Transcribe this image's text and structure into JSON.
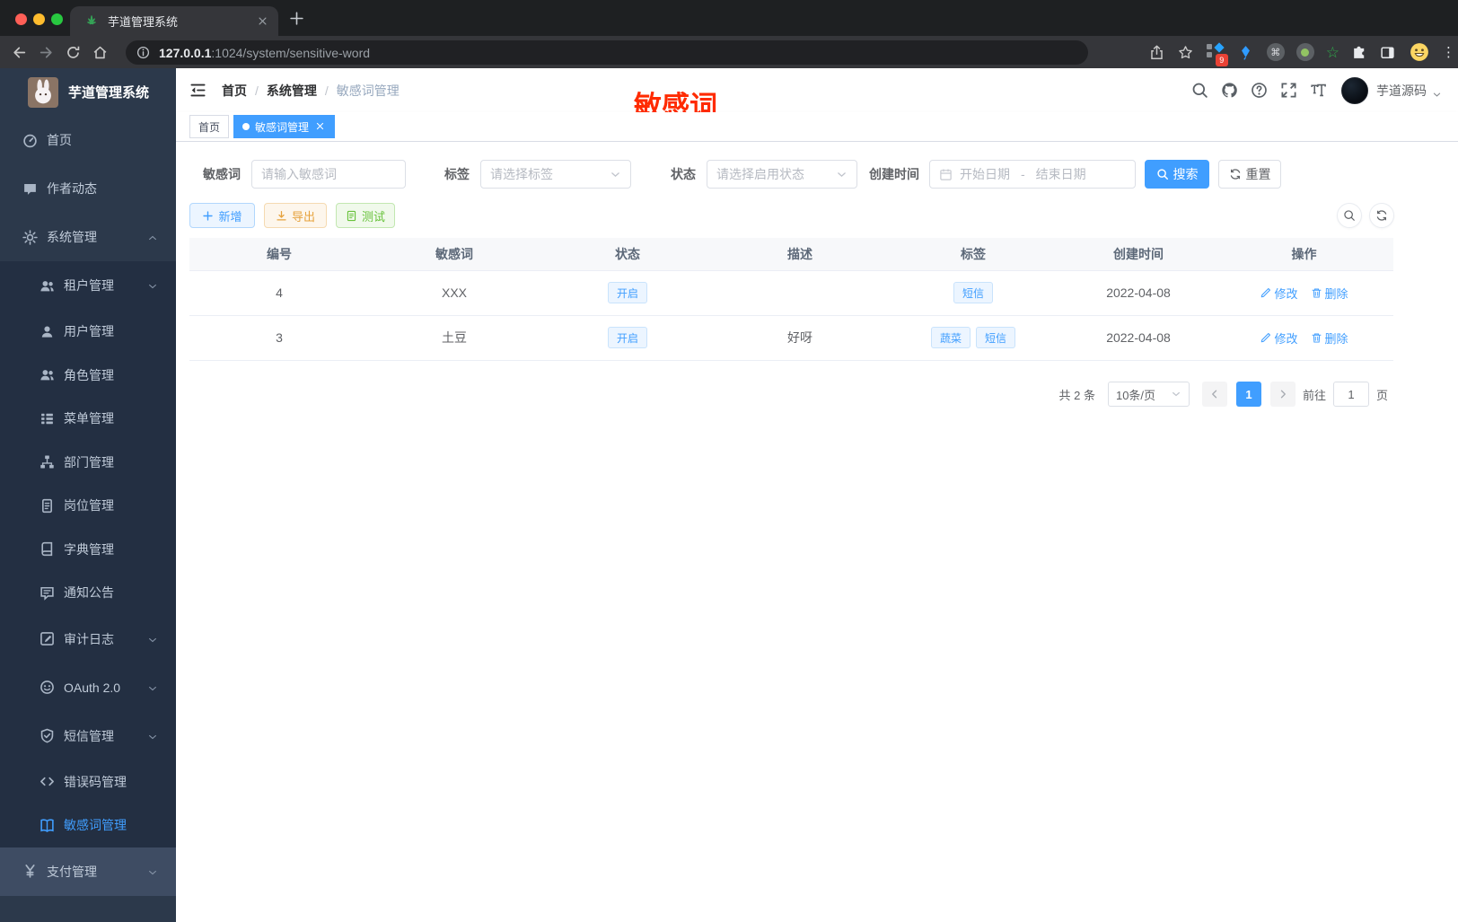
{
  "browser": {
    "tab_title": "芋道管理系统",
    "url_host": "127.0.0.1",
    "url_rest": ":1024/system/sensitive-word",
    "extensions_badge": "9"
  },
  "sidebar": {
    "logo_title": "芋道管理系统",
    "items": [
      {
        "key": "home",
        "icon": "dashboard",
        "label": "首页",
        "type": "top"
      },
      {
        "key": "author-news",
        "icon": "chat",
        "label": "作者动态",
        "type": "top"
      },
      {
        "key": "system",
        "icon": "gear",
        "label": "系统管理",
        "type": "top",
        "caret": "up"
      },
      {
        "key": "tenant",
        "icon": "users",
        "label": "租户管理",
        "type": "sub",
        "caret": "down"
      },
      {
        "key": "user",
        "icon": "user",
        "label": "用户管理",
        "type": "sub"
      },
      {
        "key": "role",
        "icon": "users",
        "label": "角色管理",
        "type": "sub"
      },
      {
        "key": "menu",
        "icon": "menu",
        "label": "菜单管理",
        "type": "sub"
      },
      {
        "key": "dept",
        "icon": "org",
        "label": "部门管理",
        "type": "sub"
      },
      {
        "key": "post",
        "icon": "post",
        "label": "岗位管理",
        "type": "sub"
      },
      {
        "key": "dict",
        "icon": "dict",
        "label": "字典管理",
        "type": "sub"
      },
      {
        "key": "notice",
        "icon": "notice",
        "label": "通知公告",
        "type": "sub"
      },
      {
        "key": "audit-log",
        "icon": "log",
        "label": "审计日志",
        "type": "sub",
        "caret": "down"
      },
      {
        "key": "oauth2",
        "icon": "oauth",
        "label": "OAuth 2.0",
        "type": "sub",
        "caret": "down"
      },
      {
        "key": "sms",
        "icon": "shield",
        "label": "短信管理",
        "type": "sub",
        "caret": "down"
      },
      {
        "key": "error-code",
        "icon": "code",
        "label": "错误码管理",
        "type": "sub"
      },
      {
        "key": "sensitive-word",
        "icon": "book",
        "label": "敏感词管理",
        "type": "sub",
        "active": true
      },
      {
        "key": "pay",
        "icon": "yen",
        "label": "支付管理",
        "type": "top",
        "caret": "down",
        "highlight": true
      }
    ]
  },
  "header": {
    "breadcrumb": [
      {
        "label": "首页"
      },
      {
        "label": "系统管理"
      },
      {
        "label": "敏感词管理",
        "current": true
      }
    ],
    "username": "芋道源码",
    "annotation": "敏感词"
  },
  "tabs": [
    {
      "key": "home",
      "label": "首页"
    },
    {
      "key": "sensitive-word",
      "label": "敏感词管理",
      "active": true,
      "closable": true
    }
  ],
  "filters": {
    "keyword": {
      "label": "敏感词",
      "placeholder": "请输入敏感词"
    },
    "tag": {
      "label": "标签",
      "placeholder": "请选择标签"
    },
    "status": {
      "label": "状态",
      "placeholder": "请选择启用状态"
    },
    "create_time": {
      "label": "创建时间",
      "start_placeholder": "开始日期",
      "separator": "-",
      "end_placeholder": "结束日期"
    },
    "search_label": "搜索",
    "reset_label": "重置"
  },
  "toolbar": {
    "add_label": "新增",
    "export_label": "导出",
    "test_label": "测试"
  },
  "table": {
    "headers": [
      "编号",
      "敏感词",
      "状态",
      "描述",
      "标签",
      "创建时间",
      "操作"
    ],
    "rows": [
      {
        "id": "4",
        "word": "XXX",
        "status": "开启",
        "description": "",
        "tags": [
          "短信"
        ],
        "created_at": "2022-04-08"
      },
      {
        "id": "3",
        "word": "土豆",
        "status": "开启",
        "description": "好呀",
        "tags": [
          "蔬菜",
          "短信"
        ],
        "created_at": "2022-04-08"
      }
    ],
    "edit_label": "修改",
    "delete_label": "删除"
  },
  "pagination": {
    "total_text": "共 2 条",
    "page_size_text": "10条/页",
    "current_page": "1",
    "goto_prefix": "前往",
    "goto_value": "1",
    "goto_suffix": "页"
  },
  "colors": {
    "primary": "#409eff",
    "annotation_red": "#ff2b00",
    "warning": "#e6a23c",
    "success": "#67c23a"
  }
}
